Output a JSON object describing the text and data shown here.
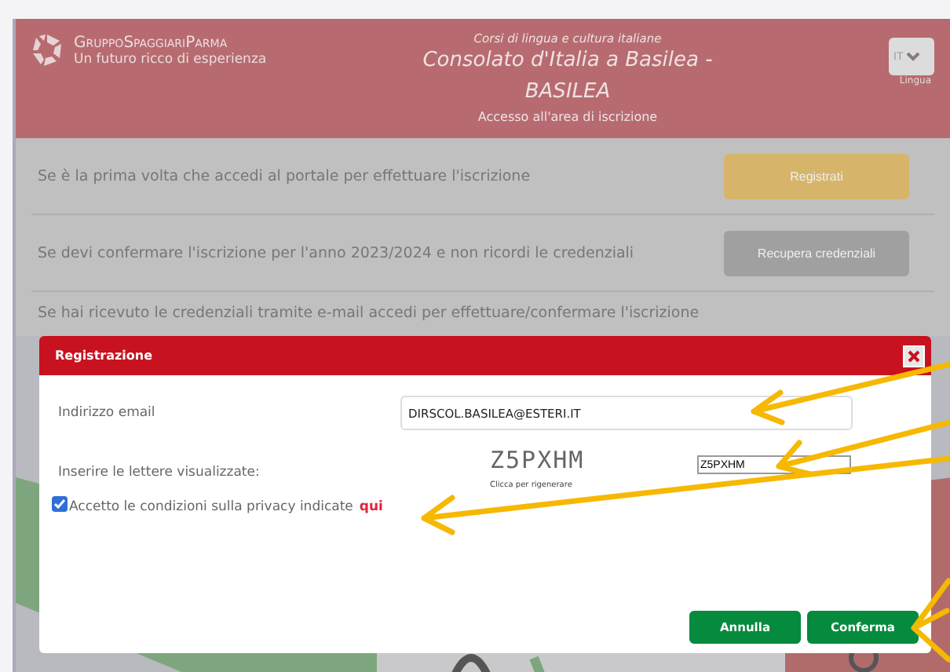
{
  "header": {
    "logo_name": "GruppoSpaggiariParma",
    "logo_tagline": "Un futuro ricco di esperienza",
    "subtitle": "Corsi di lingua e cultura italiane",
    "title": "Consolato d'Italia a Basilea - BASILEA",
    "caption": "Accesso all'area di iscrizione",
    "language": {
      "value": "IT",
      "label": "Lingua"
    }
  },
  "rows": [
    {
      "text": "Se è la prima volta che accedi al portale per effettuare l'iscrizione",
      "button": {
        "label": "Registrati",
        "kind": "primary"
      }
    },
    {
      "text": "Se devi confermare l'iscrizione per l'anno 2023/2024 e non ricordi le credenziali",
      "button": {
        "label": "Recupera credenziali",
        "kind": "secondary"
      }
    },
    {
      "text": "Se hai ricevuto le credenziali tramite e-mail accedi per effettuare/confermare l'iscrizione"
    }
  ],
  "dialog": {
    "title": "Registrazione",
    "email": {
      "label": "Indirizzo email",
      "value": "DIRSCOL.BASILEA@ESTERI.IT"
    },
    "captcha": {
      "label": "Inserire le lettere visualizzate:",
      "code": "Z5PXHM",
      "hint": "Clicca per rigenerare",
      "value": "Z5PXHM"
    },
    "privacy": {
      "checked": true,
      "text": "Accetto le condizioni sulla privacy indicate",
      "link": "qui"
    },
    "buttons": [
      "Annulla",
      "Conferma"
    ]
  }
}
